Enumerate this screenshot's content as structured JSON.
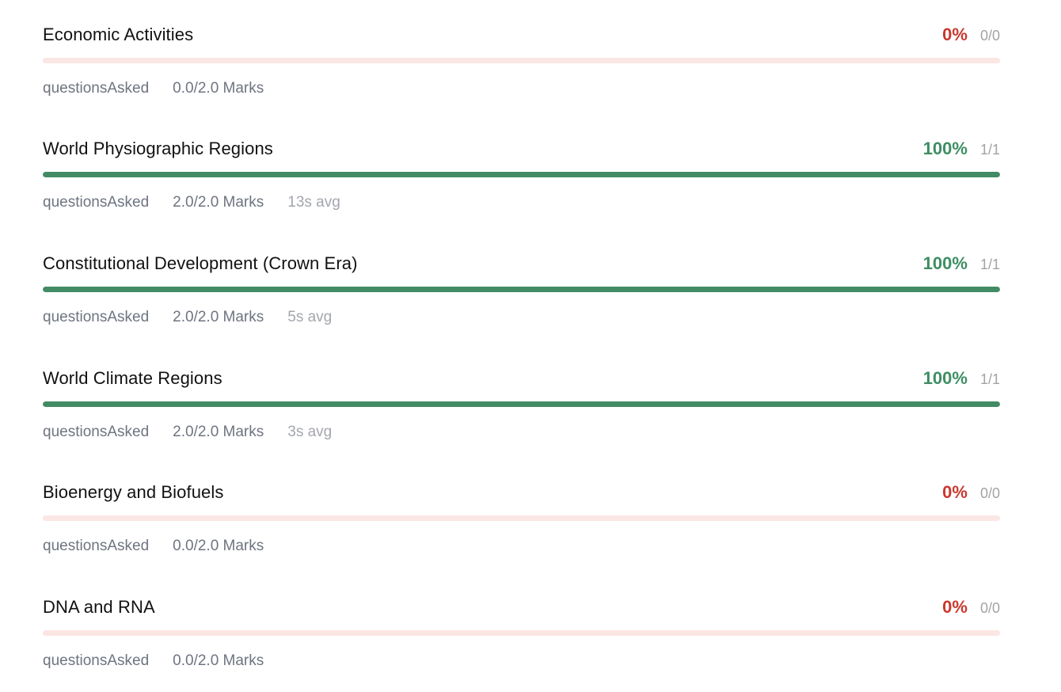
{
  "topics": [
    {
      "title": "Economic Activities",
      "percent": "0%",
      "fraction": "0/0",
      "progress": 0,
      "status": "bad",
      "questions_label": "questionsAsked",
      "marks": "0.0/2.0 Marks",
      "avg": ""
    },
    {
      "title": "World Physiographic Regions",
      "percent": "100%",
      "fraction": "1/1",
      "progress": 1,
      "status": "good",
      "questions_label": "questionsAsked",
      "marks": "2.0/2.0 Marks",
      "avg": "13s avg"
    },
    {
      "title": "Constitutional Development (Crown Era)",
      "percent": "100%",
      "fraction": "1/1",
      "progress": 1,
      "status": "good",
      "questions_label": "questionsAsked",
      "marks": "2.0/2.0 Marks",
      "avg": "5s avg"
    },
    {
      "title": "World Climate Regions",
      "percent": "100%",
      "fraction": "1/1",
      "progress": 1,
      "status": "good",
      "questions_label": "questionsAsked",
      "marks": "2.0/2.0 Marks",
      "avg": "3s avg"
    },
    {
      "title": "Bioenergy and Biofuels",
      "percent": "0%",
      "fraction": "0/0",
      "progress": 0,
      "status": "bad",
      "questions_label": "questionsAsked",
      "marks": "0.0/2.0 Marks",
      "avg": ""
    },
    {
      "title": "DNA and RNA",
      "percent": "0%",
      "fraction": "0/0",
      "progress": 0,
      "status": "bad",
      "questions_label": "questionsAsked",
      "marks": "0.0/2.0 Marks",
      "avg": ""
    }
  ],
  "colors": {
    "good": "#3e8e63",
    "bad": "#c9382e",
    "good_bar": "#438b65",
    "bad_track": "#fae6e3"
  }
}
